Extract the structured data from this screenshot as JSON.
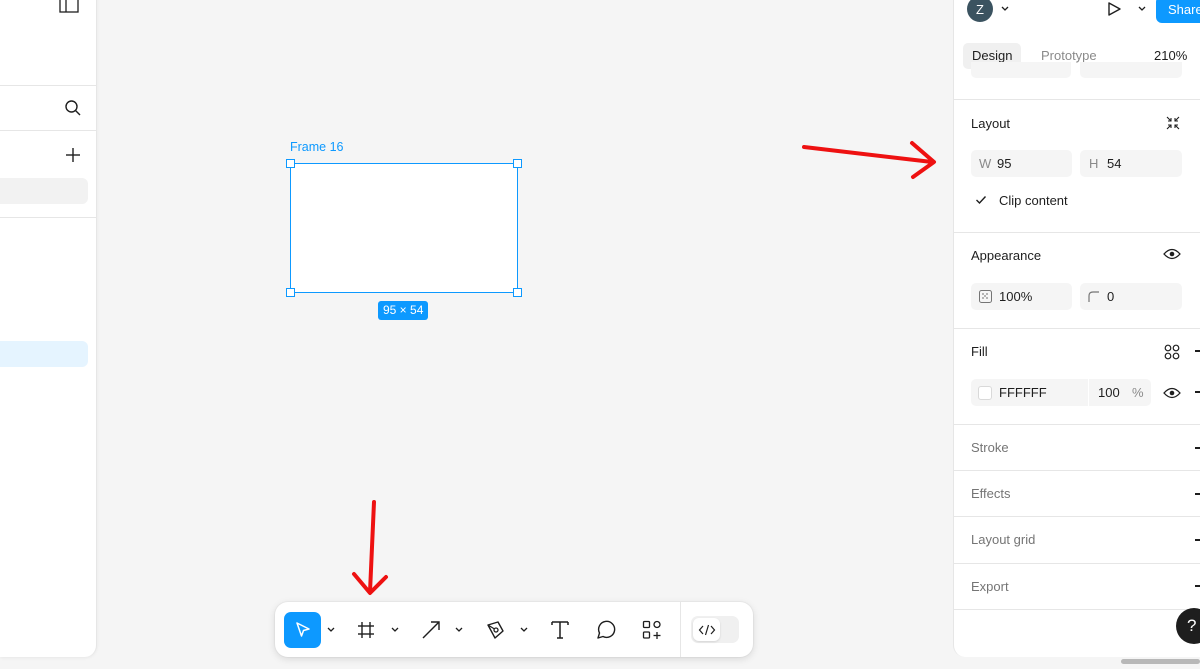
{
  "canvas": {
    "frame_label": "Frame 16",
    "size_badge": "95 × 54"
  },
  "right_panel": {
    "header": {
      "avatar_initial": "Z",
      "share_label": "Share"
    },
    "tabs": {
      "design": "Design",
      "prototype": "Prototype",
      "zoom": "210%"
    },
    "layout": {
      "title": "Layout",
      "width_prefix": "W",
      "width": "95",
      "height_prefix": "H",
      "height": "54",
      "clip_content": "Clip content",
      "clip_checked": true
    },
    "appearance": {
      "title": "Appearance",
      "opacity": "100%",
      "corner_radius": "0"
    },
    "fill": {
      "title": "Fill",
      "hex": "FFFFFF",
      "opacity": "100",
      "percent": "%"
    },
    "stroke": {
      "title": "Stroke"
    },
    "effects": {
      "title": "Effects"
    },
    "layout_grid": {
      "title": "Layout grid"
    },
    "export": {
      "title": "Export"
    }
  },
  "help": {
    "label": "?"
  },
  "colors": {
    "accent": "#0d99ff",
    "annotation_arrow": "#ee1111",
    "canvas_bg": "#f5f5f5",
    "panel_bg": "#ffffff",
    "fill_swatch": "#FFFFFF"
  },
  "icons": {
    "left_panel": [
      "panel-toggle-icon",
      "search-icon",
      "plus-icon"
    ],
    "toolbar": [
      "move-tool-icon",
      "frame-tool-icon",
      "arrow-tool-icon",
      "pen-tool-icon",
      "text-tool-icon",
      "comment-tool-icon",
      "actions-tool-icon",
      "dev-mode-icon"
    ],
    "right_panel": [
      "play-icon",
      "resize-to-fit-icon",
      "eye-icon",
      "corner-radius-icon",
      "style-grid-icon",
      "add-icon"
    ]
  }
}
